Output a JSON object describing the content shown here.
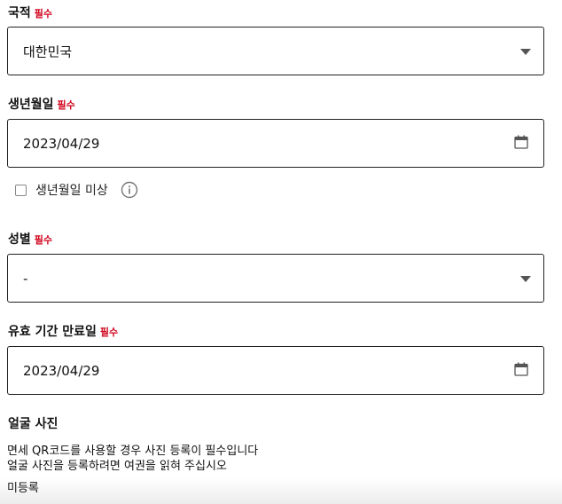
{
  "required_badge": "필수",
  "nationality": {
    "label": "국적",
    "value": "대한민국"
  },
  "birthdate": {
    "label": "생년월일",
    "value": "2023/04/29",
    "unknown_checkbox_label": "생년월일 미상"
  },
  "gender": {
    "label": "성별",
    "value": "-"
  },
  "expiry": {
    "label": "유효 기간 만료일",
    "value": "2023/04/29"
  },
  "face_photo": {
    "label": "얼굴 사진",
    "description_line1": "면세 QR코드를 사용할 경우 사진 등록이 필수입니다",
    "description_line2": "얼굴 사진을 등록하려면 여권을 읽혀 주십시오",
    "status": "미등록"
  },
  "colors": {
    "required": "#d0021b",
    "border": "#222222"
  },
  "icons": {
    "dropdown": "chevron-down-icon",
    "calendar": "calendar-icon",
    "info": "info-icon"
  }
}
